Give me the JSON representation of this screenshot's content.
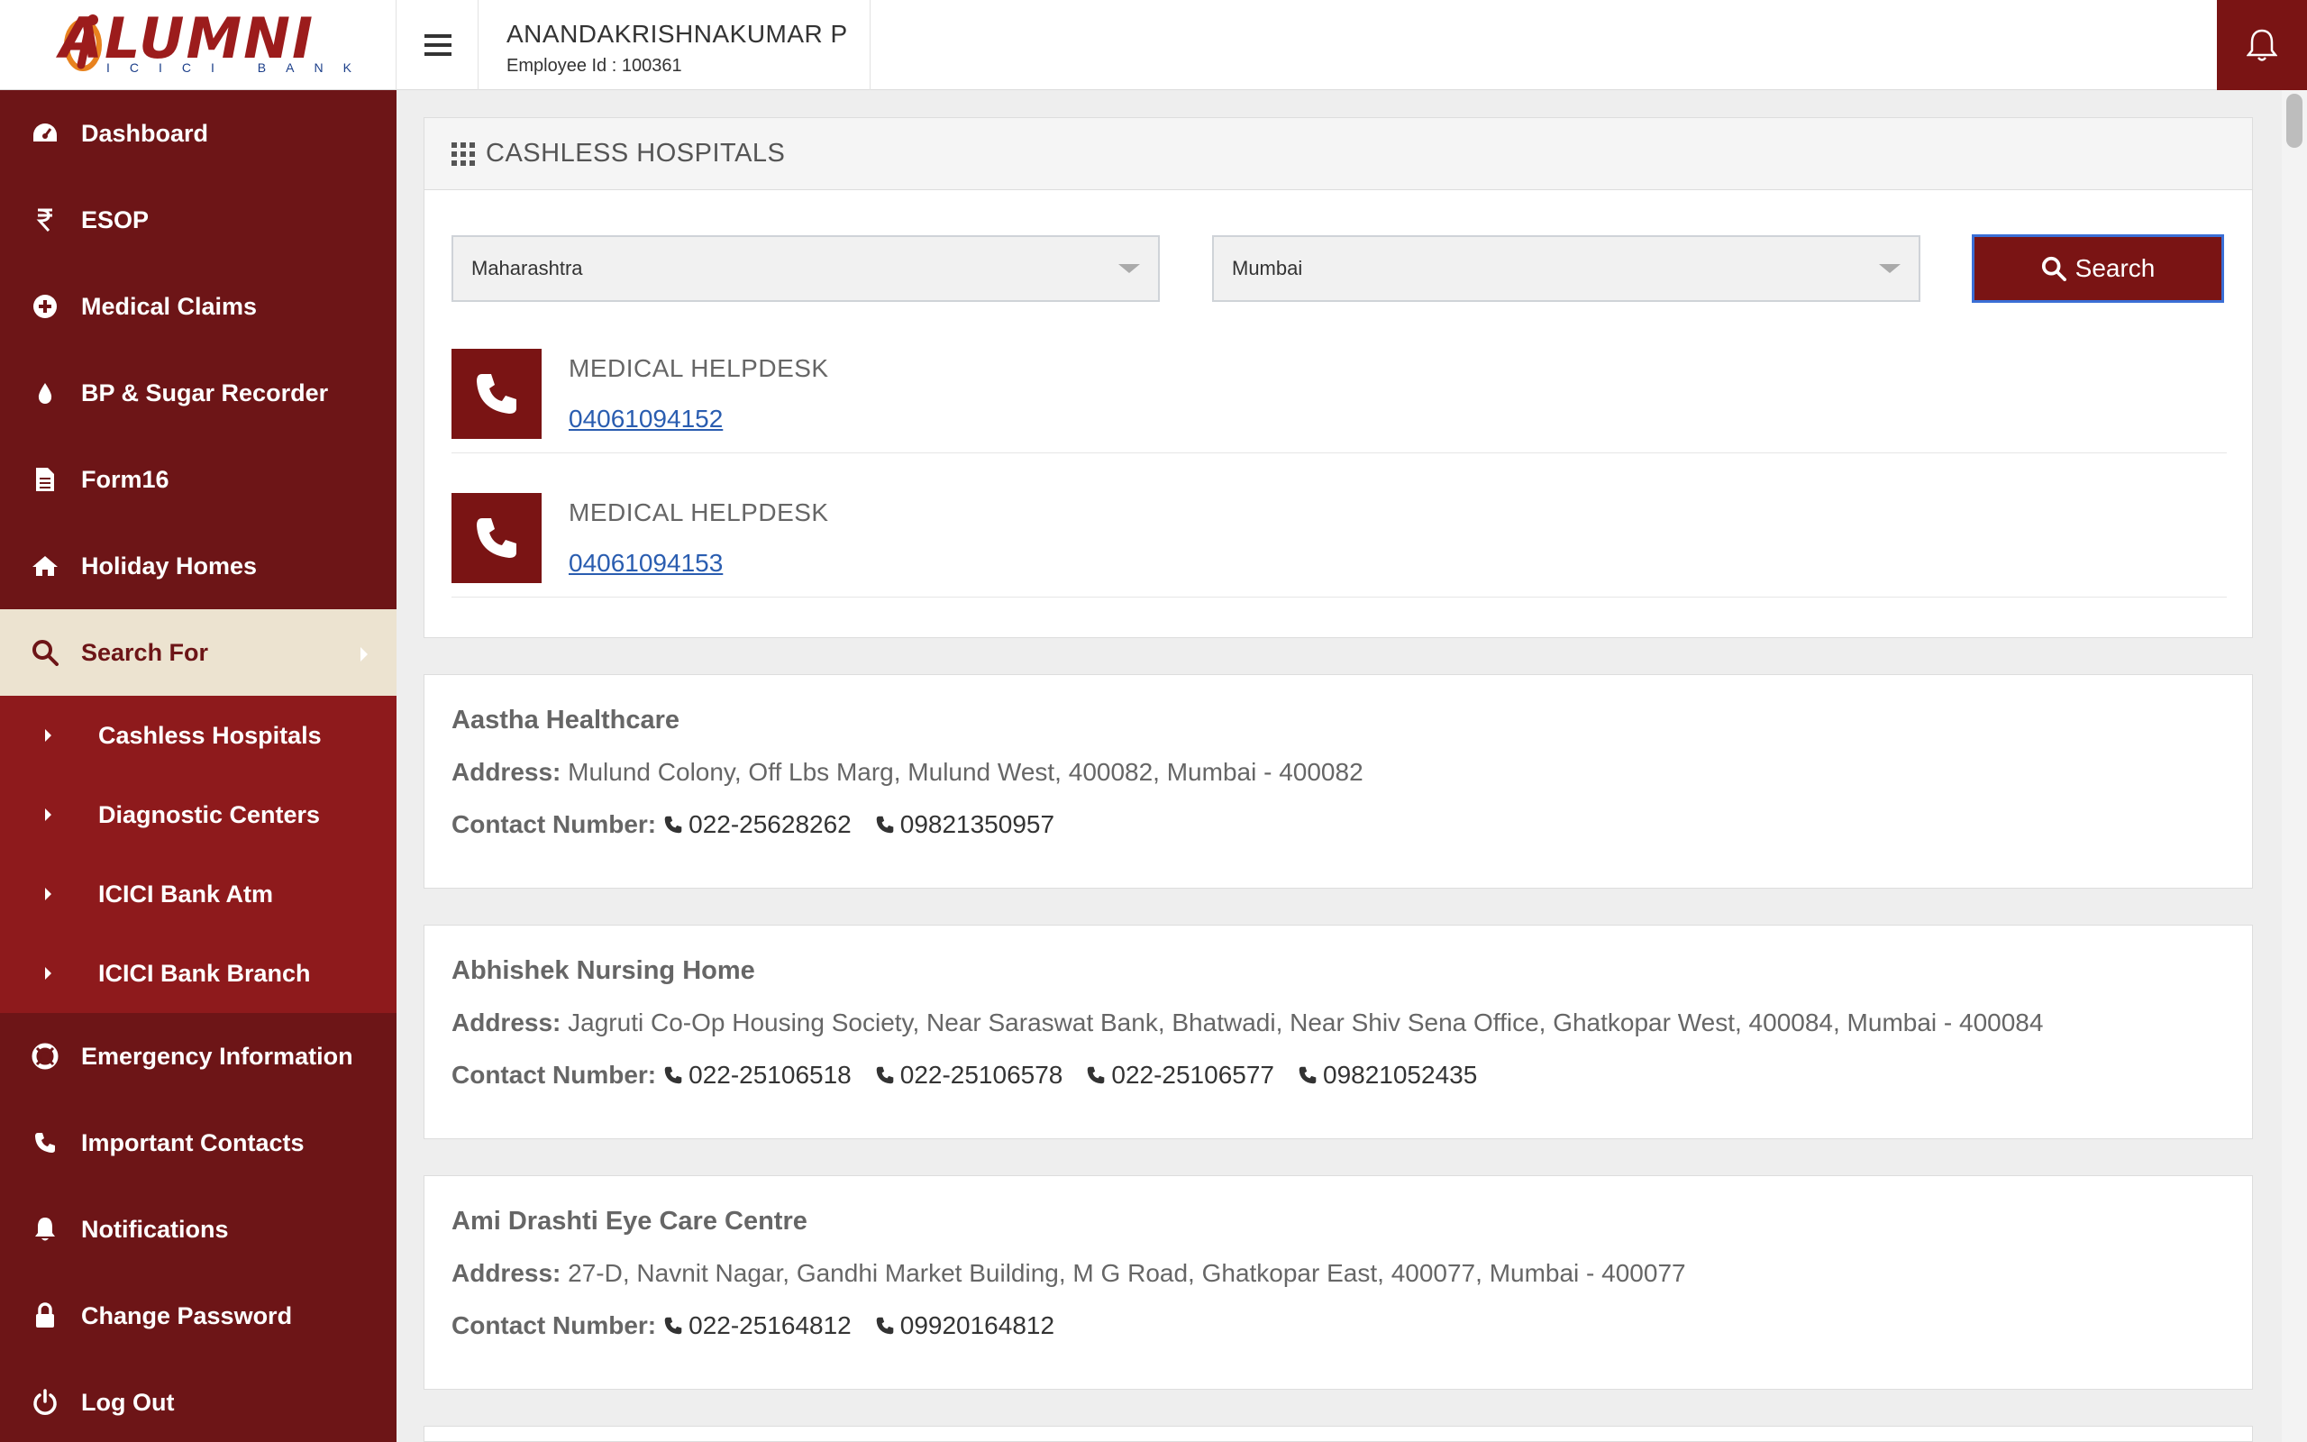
{
  "header": {
    "logo_text": "ALUMNI",
    "logo_sub": "ICICI BANK",
    "user_name": "ANANDAKRISHNAKUMAR P",
    "employee_id": "Employee Id : 100361"
  },
  "colors": {
    "primary": "#6d1517",
    "button": "#7a1414",
    "active_bg": "#ece3d0",
    "link": "#2a5db0"
  },
  "sidebar": {
    "items": [
      {
        "label": "Dashboard",
        "icon": "dashboard-icon"
      },
      {
        "label": "ESOP",
        "icon": "rupee-icon"
      },
      {
        "label": "Medical Claims",
        "icon": "plus-circle-icon"
      },
      {
        "label": "BP & Sugar Recorder",
        "icon": "drop-icon"
      },
      {
        "label": "Form16",
        "icon": "document-icon"
      },
      {
        "label": "Holiday Homes",
        "icon": "home-icon"
      },
      {
        "label": "Search For",
        "icon": "search-icon"
      }
    ],
    "submenu": [
      {
        "label": "Cashless Hospitals"
      },
      {
        "label": "Diagnostic Centers"
      },
      {
        "label": "ICICI Bank Atm"
      },
      {
        "label": "ICICI Bank Branch"
      }
    ],
    "items_after": [
      {
        "label": "Emergency Information",
        "icon": "lifebuoy-icon"
      },
      {
        "label": "Important Contacts",
        "icon": "phone-icon"
      },
      {
        "label": "Notifications",
        "icon": "bell-icon"
      },
      {
        "label": "Change Password",
        "icon": "lock-icon"
      },
      {
        "label": "Log Out",
        "icon": "power-icon"
      }
    ]
  },
  "main": {
    "title": "CASHLESS HOSPITALS",
    "state_select": "Maharashtra",
    "city_select": "Mumbai",
    "search_label": "Search",
    "helpdesk": [
      {
        "title": "MEDICAL HELPDESK",
        "number": "04061094152"
      },
      {
        "title": "MEDICAL HELPDESK",
        "number": "04061094153"
      }
    ],
    "address_key": "Address:",
    "contact_key": "Contact Number:",
    "hospitals": [
      {
        "name": "Aastha Healthcare",
        "address": "Mulund Colony, Off Lbs Marg, Mulund West, 400082, Mumbai - 400082",
        "phones": [
          "022-25628262",
          "09821350957"
        ]
      },
      {
        "name": "Abhishek Nursing Home",
        "address": "Jagruti Co-Op Housing Society, Near Saraswat Bank, Bhatwadi, Near Shiv Sena Office, Ghatkopar West, 400084, Mumbai - 400084",
        "phones": [
          "022-25106518",
          "022-25106578",
          "022-25106577",
          "09821052435"
        ]
      },
      {
        "name": "Ami Drashti Eye Care Centre",
        "address": "27-D, Navnit Nagar, Gandhi Market Building, M G Road, Ghatkopar East, 400077, Mumbai - 400077",
        "phones": [
          "022-25164812",
          "09920164812"
        ]
      }
    ]
  }
}
